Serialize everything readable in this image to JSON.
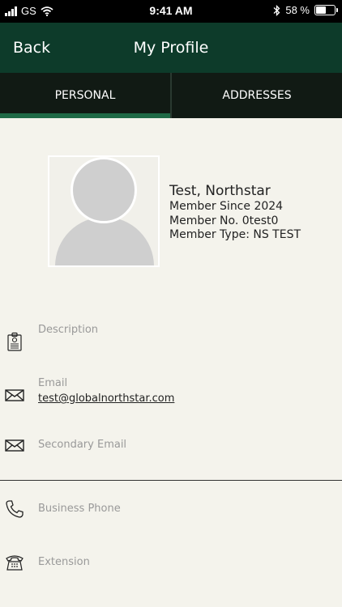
{
  "status_bar": {
    "carrier": "GS",
    "time": "9:41 AM",
    "battery_text": "58 %",
    "battery_level": 0.58
  },
  "nav": {
    "back_label": "Back",
    "title": "My Profile"
  },
  "tabs": [
    {
      "label": "PERSONAL",
      "active": true
    },
    {
      "label": "ADDRESSES",
      "active": false
    }
  ],
  "profile": {
    "name": "Test, Northstar",
    "member_since": "Member Since 2024",
    "member_no": "Member No. 0test0",
    "member_type": "Member Type: NS TEST"
  },
  "fields": [
    {
      "icon": "badge-icon",
      "label": "Description",
      "value": ""
    },
    {
      "icon": "envelope-icon",
      "label": "Email",
      "value": "test@globalnorthstar.com"
    },
    {
      "icon": "envelope-icon",
      "label": "Secondary Email",
      "value": ""
    },
    {
      "icon": "phone-icon",
      "label": "Business Phone",
      "value": ""
    },
    {
      "icon": "desk-phone-icon",
      "label": "Extension",
      "value": ""
    }
  ],
  "colors": {
    "nav_bg": "#0d3b2a",
    "tab_bg": "#111a14",
    "tab_indicator": "#1f6a46",
    "page_bg": "#f4f3ec"
  }
}
